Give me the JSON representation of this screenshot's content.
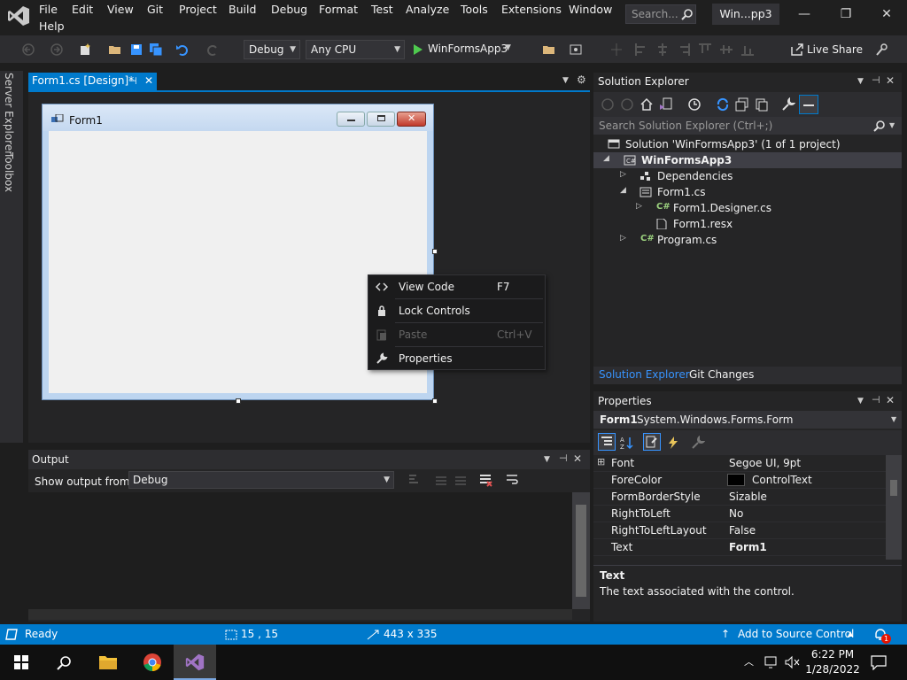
{
  "menubar": {
    "items": [
      "File",
      "Edit",
      "View",
      "Git",
      "Project",
      "Build",
      "Debug",
      "Format",
      "Test",
      "Analyze",
      "Tools",
      "Extensions",
      "Window",
      "Help"
    ],
    "search_placeholder": "Search...",
    "title": "Win...pp3"
  },
  "toolbar": {
    "config": "Debug",
    "platform": "Any CPU",
    "run_target": "WinFormsApp3",
    "live_share": "Live Share"
  },
  "left_tabs": [
    "Server Explorer",
    "Toolbox"
  ],
  "document": {
    "tab_label": "Form1.cs [Design]*",
    "form_title": "Form1"
  },
  "context_menu": {
    "items": [
      {
        "label": "View Code",
        "shortcut": "F7",
        "icon": "code-icon",
        "enabled": true
      },
      {
        "label": "Lock Controls",
        "shortcut": "",
        "icon": "lock-icon",
        "enabled": true
      },
      {
        "label": "Paste",
        "shortcut": "Ctrl+V",
        "icon": "paste-icon",
        "enabled": false
      },
      {
        "label": "Properties",
        "shortcut": "",
        "icon": "wrench-icon",
        "enabled": true
      }
    ]
  },
  "output": {
    "title": "Output",
    "show_from_label": "Show output from:",
    "source": "Debug"
  },
  "solution_explorer": {
    "title": "Solution Explorer",
    "search_placeholder": "Search Solution Explorer (Ctrl+;)",
    "tree": [
      {
        "label": "Solution 'WinFormsApp3' (1 of 1 project)",
        "bold": false
      },
      {
        "label": "WinFormsApp3",
        "bold": true
      },
      {
        "label": "Dependencies",
        "bold": false
      },
      {
        "label": "Form1.cs",
        "bold": false
      },
      {
        "label": "Form1.Designer.cs",
        "bold": false
      },
      {
        "label": "Form1.resx",
        "bold": false
      },
      {
        "label": "Program.cs",
        "bold": false
      }
    ],
    "tabs": [
      "Solution Explorer",
      "Git Changes"
    ]
  },
  "properties": {
    "title": "Properties",
    "object_name": "Form1",
    "object_type": "System.Windows.Forms.Form",
    "rows": [
      {
        "name": "Font",
        "value": "Segoe UI, 9pt"
      },
      {
        "name": "ForeColor",
        "value": "ControlText"
      },
      {
        "name": "FormBorderStyle",
        "value": "Sizable"
      },
      {
        "name": "RightToLeft",
        "value": "No"
      },
      {
        "name": "RightToLeftLayout",
        "value": "False"
      },
      {
        "name": "Text",
        "value": "Form1"
      }
    ],
    "desc_title": "Text",
    "desc_text": "The text associated with the control."
  },
  "statusbar": {
    "status": "Ready",
    "position": "15 , 15",
    "size": "443 x 335",
    "source_control": "Add to Source Control",
    "notification_count": "1"
  },
  "taskbar": {
    "time": "6:22 PM",
    "date": "1/28/2022"
  },
  "colors": {
    "accent": "#007acc",
    "background": "#1e1e1e",
    "panel": "#252526"
  }
}
